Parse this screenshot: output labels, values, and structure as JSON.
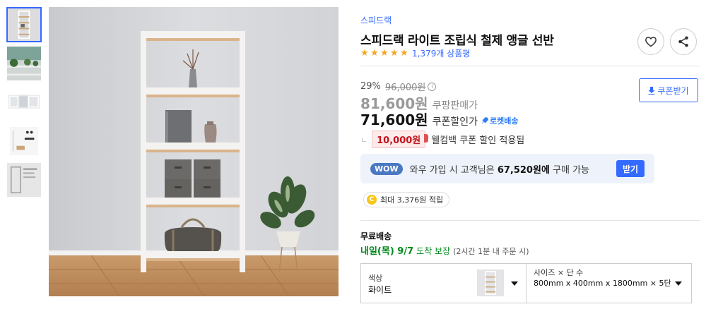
{
  "thumbnails": [
    {
      "name": "thumb-1",
      "alt": "shelf-white"
    },
    {
      "name": "thumb-2",
      "alt": "plants-on-shelf"
    },
    {
      "name": "thumb-3",
      "alt": "shelf-wide"
    },
    {
      "name": "thumb-4",
      "alt": "parts"
    },
    {
      "name": "thumb-5",
      "alt": "size-chart"
    }
  ],
  "product": {
    "brand": "스피드랙",
    "title": "스피드랙 라이트 조립식 철제 앵글 선반",
    "rating_stars": 5,
    "review_count": "1,379개 상품평"
  },
  "price": {
    "discount_rate": "29%",
    "original_price": "96,000원",
    "sale_price": "81,600원",
    "sale_label": "쿠팡판매가",
    "coupon_price": "71,600원",
    "coupon_label": "쿠폰할인가",
    "rocket_label": "로켓배송",
    "coupon_button": "쿠폰받기"
  },
  "welcome": {
    "amount": "10,000원",
    "text": "웰컴백 쿠폰 할인 적용됨"
  },
  "wow": {
    "badge": "WOW",
    "text_before": "와우 가입 시 고객님은",
    "amount": "67,520원에",
    "text_after": "구매 가능",
    "button": "받기"
  },
  "cash": {
    "coin": "C",
    "text": "최대 3,376원 적립"
  },
  "shipping": {
    "title": "무료배송",
    "date": "내일(목) 9/7",
    "guarantee": "도착 보장",
    "note": "(2시간 1분 내 주문 시)"
  },
  "options": {
    "color_label": "색상",
    "color_value": "화이트",
    "size_label": "사이즈 × 단 수",
    "size_value": "800mm x 400mm x 1800mm × 5단"
  },
  "colors": {
    "accent": "#346aff",
    "price_red": "#c5141d",
    "green": "#00891a",
    "star": "#f5a623"
  }
}
